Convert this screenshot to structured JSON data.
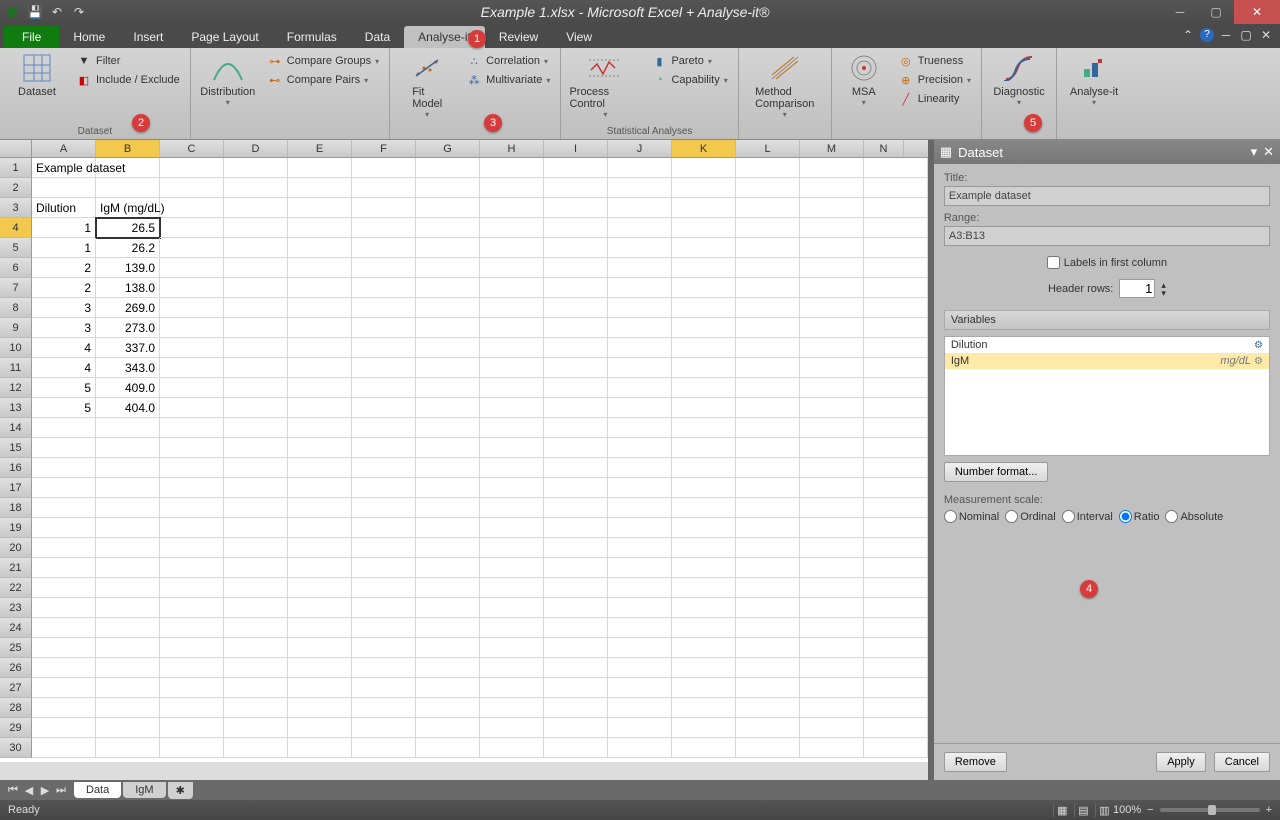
{
  "titlebar": {
    "title": "Example 1.xlsx - Microsoft Excel + Analyse-it®"
  },
  "tabs": {
    "file": "File",
    "home": "Home",
    "insert": "Insert",
    "page_layout": "Page Layout",
    "formulas": "Formulas",
    "data": "Data",
    "analyse_it": "Analyse-it",
    "review": "Review",
    "view": "View"
  },
  "ribbon": {
    "dataset": {
      "btn": "Dataset",
      "filter": "Filter",
      "include": "Include / Exclude",
      "label": "Dataset"
    },
    "dist": {
      "btn": "Distribution",
      "cg": "Compare Groups",
      "cp": "Compare Pairs"
    },
    "fit": {
      "btn": "Fit\nModel",
      "corr": "Correlation",
      "multi": "Multivariate"
    },
    "pc": {
      "btn": "Process Control",
      "pareto": "Pareto",
      "cap": "Capability"
    },
    "mc": {
      "btn": "Method\nComparison"
    },
    "msa": {
      "btn": "MSA",
      "true": "Trueness",
      "prec": "Precision",
      "lin": "Linearity"
    },
    "diag": {
      "btn": "Diagnostic"
    },
    "ai": {
      "btn": "Analyse-it"
    },
    "stat_label": "Statistical Analyses"
  },
  "columns": [
    "A",
    "B",
    "C",
    "D",
    "E",
    "F",
    "G",
    "H",
    "I",
    "J",
    "K",
    "L",
    "M",
    "N"
  ],
  "sheet": {
    "title_cell": "Example dataset",
    "headers": [
      "Dilution",
      "IgM (mg/dL)"
    ],
    "rows": [
      {
        "a": "1",
        "b": "26.5"
      },
      {
        "a": "1",
        "b": "26.2"
      },
      {
        "a": "2",
        "b": "139.0"
      },
      {
        "a": "2",
        "b": "138.0"
      },
      {
        "a": "3",
        "b": "269.0"
      },
      {
        "a": "3",
        "b": "273.0"
      },
      {
        "a": "4",
        "b": "337.0"
      },
      {
        "a": "4",
        "b": "343.0"
      },
      {
        "a": "5",
        "b": "409.0"
      },
      {
        "a": "5",
        "b": "404.0"
      }
    ]
  },
  "pane": {
    "header": "Dataset",
    "title_label": "Title:",
    "title_value": "Example dataset",
    "range_label": "Range:",
    "range_value": "A3:B13",
    "labels_check": "Labels in first column",
    "header_rows_label": "Header rows:",
    "header_rows_value": "1",
    "variables_label": "Variables",
    "var1": "Dilution",
    "var2": "IgM",
    "var2_unit": "mg/dL",
    "numfmt": "Number format...",
    "scale_label": "Measurement scale:",
    "scales": {
      "nominal": "Nominal",
      "ordinal": "Ordinal",
      "interval": "Interval",
      "ratio": "Ratio",
      "absolute": "Absolute"
    },
    "remove": "Remove",
    "apply": "Apply",
    "cancel": "Cancel"
  },
  "sheettabs": {
    "data": "Data",
    "igm": "IgM"
  },
  "status": {
    "ready": "Ready",
    "zoom": "100%"
  },
  "badges": {
    "b1": "1",
    "b2": "2",
    "b3": "3",
    "b4": "4",
    "b5": "5"
  }
}
